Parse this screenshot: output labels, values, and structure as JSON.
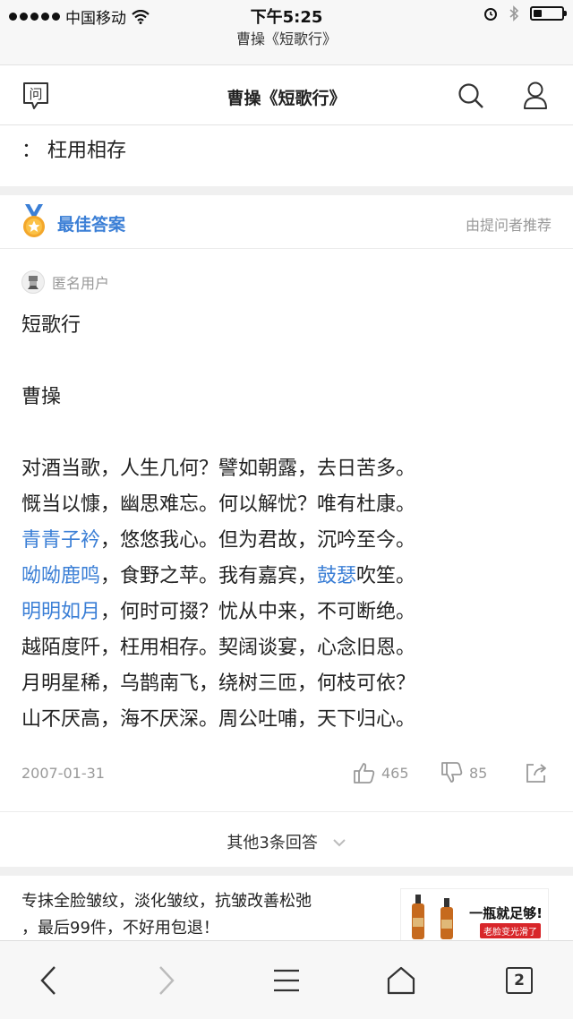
{
  "status_bar": {
    "carrier": "中国移动",
    "time": "下午5:25",
    "battery_level": 0.3
  },
  "url_bar": {
    "title": "曹操《短歌行》"
  },
  "header": {
    "title": "曹操《短歌行》",
    "icons": {
      "ask": "ask-icon",
      "search": "search-icon",
      "user": "user-icon"
    }
  },
  "excerpt": "：  枉用相存",
  "best_answer": {
    "label": "最佳答案",
    "recommended_by": "由提问者推荐",
    "user": "匿名用户",
    "title": "短歌行",
    "author": "曹操",
    "lines": [
      [
        {
          "t": "对酒当歌，人生几何？譬如朝露，去日苦多。",
          "hl": false
        }
      ],
      [
        {
          "t": "慨当以慷，幽思难忘。何以解忧？唯有杜康。",
          "hl": false
        }
      ],
      [
        {
          "t": "青青子衿",
          "hl": true
        },
        {
          "t": "，悠悠我心。但为君故，沉吟至今。",
          "hl": false
        }
      ],
      [
        {
          "t": "呦呦鹿鸣",
          "hl": true
        },
        {
          "t": "，食野之苹。我有嘉宾，",
          "hl": false
        },
        {
          "t": "鼓瑟",
          "hl": true
        },
        {
          "t": "吹笙。",
          "hl": false
        }
      ],
      [
        {
          "t": "明明如月",
          "hl": true
        },
        {
          "t": "，何时可掇？忧从中来，不可断绝。",
          "hl": false
        }
      ],
      [
        {
          "t": "越陌度阡，枉用相存。契阔谈宴，心念旧恩。",
          "hl": false
        }
      ],
      [
        {
          "t": "月明星稀，乌鹊南飞，绕树三匝，何枝可依？",
          "hl": false
        }
      ],
      [
        {
          "t": "山不厌高，海不厌深。周公吐哺，天下归心。",
          "hl": false
        }
      ]
    ],
    "date": "2007-01-31",
    "likes": "465",
    "dislikes": "85"
  },
  "other_answers": "其他3条回答",
  "ad": {
    "text_line1": "专抹全脸皱纹，淡化皱纹，抗皱改善松弛",
    "text_line2": "，最后99件，不好用包退！",
    "image_slogan": "一瓶就足够!",
    "image_sub": "老脸变光滑了"
  },
  "toolbar": {
    "tab_count": "2"
  },
  "colors": {
    "accent": "#3b7fd6",
    "muted": "#999999"
  }
}
